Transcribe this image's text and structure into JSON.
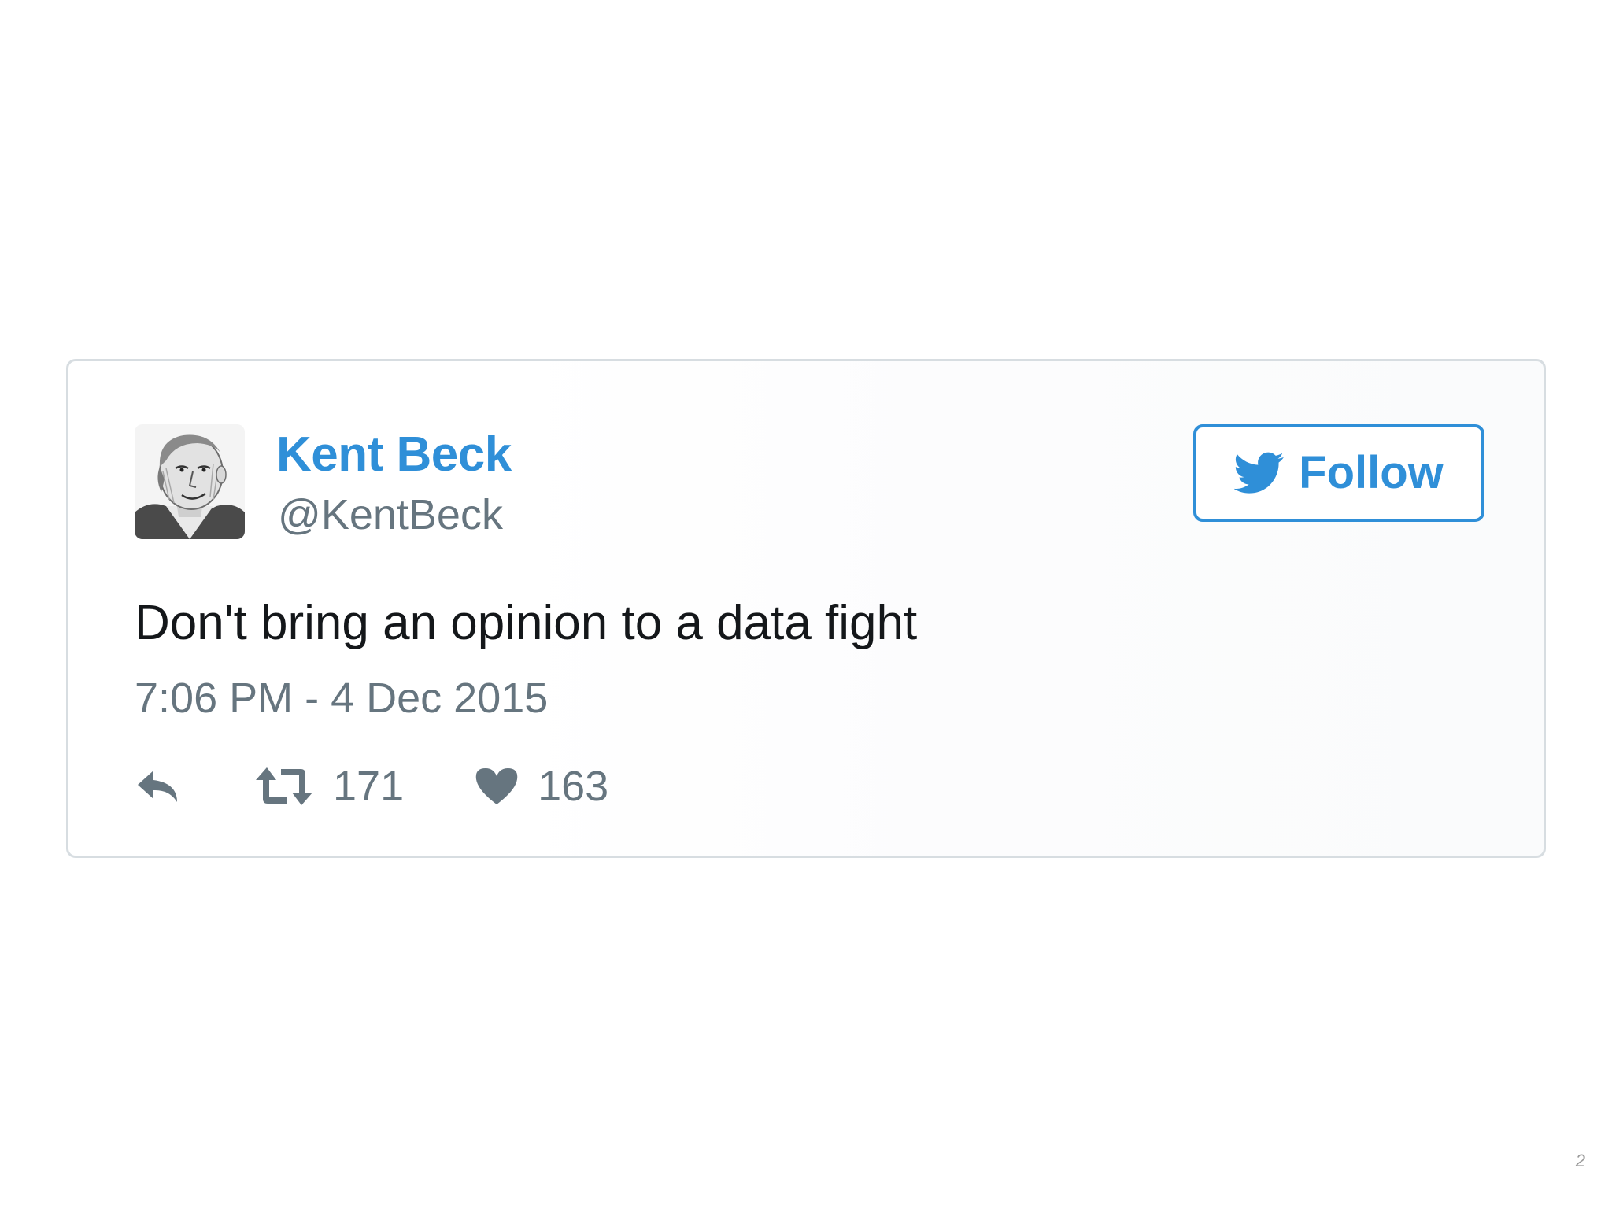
{
  "tweet": {
    "author": {
      "display_name": "Kent Beck",
      "handle": "@KentBeck",
      "avatar_icon": "portrait-sketch-avatar"
    },
    "follow_button": {
      "label": "Follow",
      "icon": "twitter-bird-icon"
    },
    "text": "Don't bring an opinion to a data fight",
    "timestamp": "7:06 PM - 4 Dec 2015",
    "actions": {
      "reply_icon": "reply-arrow-icon",
      "retweet_icon": "retweet-icon",
      "retweet_count": "171",
      "like_icon": "heart-icon",
      "like_count": "163"
    }
  },
  "slide": {
    "page_number": "2"
  },
  "colors": {
    "accent": "#2f8fd8",
    "secondary_text": "#66757f",
    "primary_text": "#14171a",
    "card_border": "#d7dde1"
  }
}
